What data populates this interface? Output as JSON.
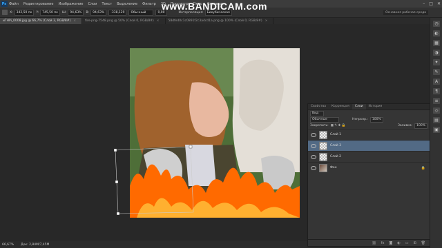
{
  "menu": {
    "logo": "Ps",
    "items": [
      "Файл",
      "Редактирование",
      "Изображение",
      "Слои",
      "Текст",
      "Выделение",
      "Фильтр",
      "3D",
      "Просмотр",
      "Окно",
      "Справка"
    ],
    "window_controls": [
      "–",
      "□",
      "✕"
    ]
  },
  "watermark": "www.BANDICAM.com",
  "options": {
    "x": "342,50 пк",
    "y": "745,50 пк",
    "w": "94,63%",
    "h": "94,63%",
    "angle": "-338,129",
    "blend": "Обычный",
    "opacity": "0,00",
    "interp_label": "Интерполяция:",
    "interp": "Бикубическая",
    "workspace": "Основная рабочая среда"
  },
  "tabs": [
    {
      "label": "иTHPi_0008.jpg @ 66,7% (Слой 3, RGB/8#)",
      "active": true
    },
    {
      "label": "fire-png-7548.png @ 50% (Слой 0, RGB/8#)",
      "active": false
    },
    {
      "label": "58dfed0c1c0891f2c3a4cd1a.png @ 100% (Слой 0, RGB/8#)",
      "active": false
    }
  ],
  "status": {
    "zoom": "66,67%",
    "doc": "Док: 2,84M/7,45M"
  },
  "layers_panel": {
    "tabs": [
      "Свойства",
      "Коррекция",
      "Слои",
      "История"
    ],
    "active_tab": "Слои",
    "kind_label": "Вид",
    "blend": "Обычные",
    "opacity_label": "Непрозр.:",
    "opacity": "100%",
    "lock_label": "Закрепить:",
    "fill_label": "Заливка:",
    "fill": "100%",
    "layers": [
      {
        "name": "Слой 1",
        "selected": false,
        "thumb": "checker",
        "locked": false
      },
      {
        "name": "Слой 3",
        "selected": true,
        "thumb": "checker",
        "locked": false
      },
      {
        "name": "Слой 2",
        "selected": false,
        "thumb": "checker",
        "locked": false
      },
      {
        "name": "Фон",
        "selected": false,
        "thumb": "photo",
        "locked": true
      }
    ],
    "footer_icons": [
      "link-icon",
      "fx-icon",
      "mask-icon",
      "adjustment-icon",
      "folder-icon",
      "new-layer-icon",
      "trash-icon"
    ]
  },
  "colors": {
    "menu_bg": "#3c3c3c",
    "canvas_bg": "#282828",
    "panel_bg": "#353535",
    "layer_selected": "#526a85",
    "fire_orange": "#ff7a10"
  }
}
